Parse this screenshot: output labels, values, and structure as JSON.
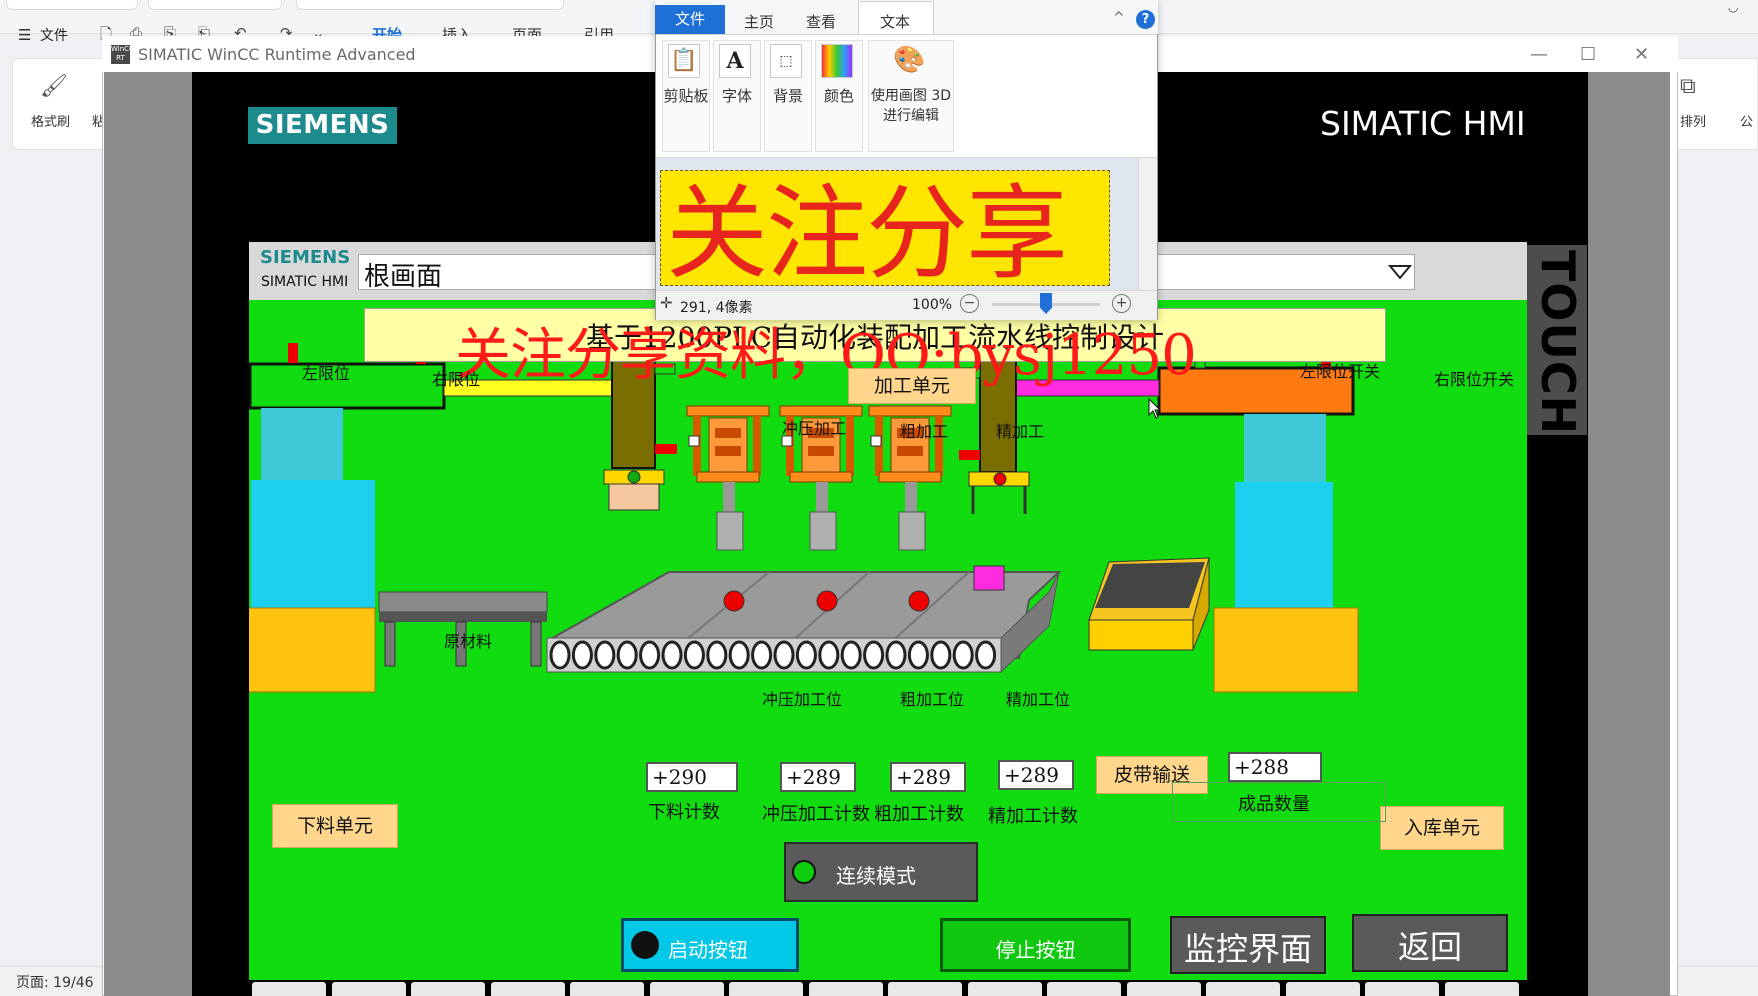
{
  "wps": {
    "file_menu": "文件",
    "menu_tabs": [
      "开始",
      "插入",
      "页面",
      "引用"
    ],
    "format_brush": "格式刷",
    "paste_short": "粘",
    "arrange_label": "排列",
    "public_label": "公",
    "page_indicator": "页面: 19/46"
  },
  "wincc": {
    "window_title": "SIMATIC WinCC Runtime Advanced",
    "app_icon_text": "WinCC RT"
  },
  "hmi": {
    "brand_logo": "SIEMENS",
    "panel_title": "SIMATIC HMI",
    "touch_label": "TOUCH",
    "header_brand": "SIEMENS",
    "header_sub": "SIMATIC HMI",
    "screen_name": "根画面",
    "banner_title": "基于1200PLC自动化装配加工流水线控制设计",
    "watermark": "关注分享资料，QQ:bysj1250",
    "labels": {
      "left_limit": "左限位",
      "right_limit": "右限位",
      "left_limit_switch": "左限位开关",
      "right_limit_switch": "右限位开关",
      "processing_unit": "加工单元",
      "stamping": "冲压加工",
      "rough": "粗加工",
      "finishing": "精加工",
      "raw_material": "原材料",
      "stamping_station": "冲压加工位",
      "rough_station": "粗加工位",
      "finishing_station": "精加工位",
      "belt_conveyor": "皮带输送",
      "unloading_unit": "下料单元",
      "storage_unit": "入库单元"
    },
    "counters": [
      {
        "value": "+290",
        "label": "下料计数"
      },
      {
        "value": "+289",
        "label": "冲压加工计数"
      },
      {
        "value": "+289",
        "label": "粗加工计数"
      },
      {
        "value": "+289",
        "label": "精加工计数"
      },
      {
        "value": "+288",
        "label": "成品数量"
      }
    ],
    "buttons": {
      "continuous_mode": "连续模式",
      "start": "启动按钮",
      "stop": "停止按钮",
      "monitor": "监控界面",
      "back": "返回"
    }
  },
  "paint": {
    "tabs": [
      "文件",
      "主页",
      "查看",
      "文本"
    ],
    "ribbon": [
      {
        "label": "剪贴板",
        "icon": "clipboard-icon"
      },
      {
        "label": "字体",
        "icon": "font-icon"
      },
      {
        "label": "背景",
        "icon": "background-icon"
      },
      {
        "label": "颜色",
        "icon": "color-icon"
      },
      {
        "label": "使用画图 3D 进行编辑",
        "icon": "paint3d-icon"
      }
    ],
    "canvas_text": "关注分享",
    "cursor_pos": "291, 4像素",
    "zoom": "100%"
  },
  "colors": {
    "hmi_green": "#10dc10",
    "siemens_teal": "#1d8a8e",
    "banner_yellow": "#ffffa6",
    "watermark_red": "#ff1a1a",
    "paint_accent": "#1e6fd6"
  }
}
